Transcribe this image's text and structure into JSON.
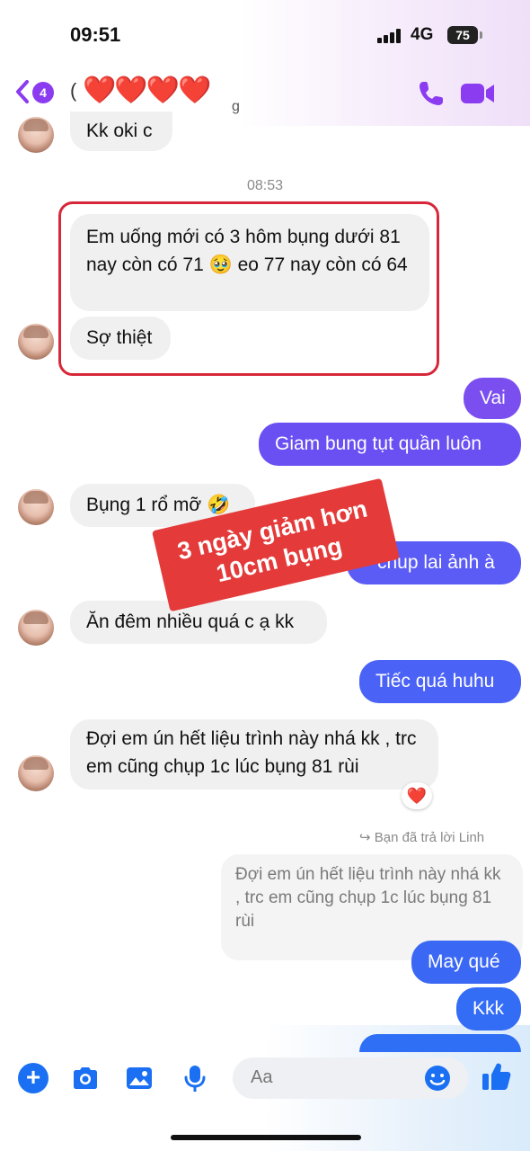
{
  "status_bar": {
    "time": "09:51",
    "network": "4G",
    "battery": "75"
  },
  "header": {
    "unread_count": "4",
    "name_fragment_start": "(",
    "name_hearts": "❤️❤️❤️❤️",
    "name_fragment_end": "g"
  },
  "conversation": {
    "msg_kk_oki": "Kk oki c",
    "timestamp": "08:53",
    "msg_em_uong": "Em uống mới có 3 hôm bụng dưới 81 nay còn có 71 🥹 eo 77 nay còn có 64",
    "msg_so_thiet": "Sợ thiệt",
    "msg_vai": "Vai",
    "msg_giam_bung": "Giam bung tụt quần luôn",
    "msg_bung_1_ro_mo": "Bụng 1 rổ mỡ 🤣",
    "msg_chup_lai_anh": "chup lai ảnh à",
    "msg_an_dem": "Ăn đêm nhiều quá c ạ kk",
    "msg_tiec_qua": "Tiếc quá huhu",
    "msg_doi_em": "Đợi em ún hết liệu trình này nhá kk , trc em cũng chụp 1c lúc bụng 81 rùi",
    "reaction": "❤️",
    "reply_label": "↪ Bạn đã trả lời Linh",
    "quoted_text": "Đợi em ún hết liệu trình này nhá kk , trc em cũng chụp 1c lúc bụng 81 rùi",
    "msg_may_que": "May qué",
    "msg_kkk": "Kkk"
  },
  "sticker": {
    "line1": "3 ngày giảm hơn",
    "line2": "10cm bụng"
  },
  "composer": {
    "placeholder": "Aa"
  },
  "colors": {
    "outgoing_top": "#7b4ef0",
    "outgoing_mid": "#5b5cf6",
    "outgoing_bottom": "#2f6ff5",
    "incoming": "#f0f0f0",
    "accent_purple": "#8b3cf0",
    "icon_blue": "#1a6ff3",
    "highlight_red": "#d6283a"
  }
}
